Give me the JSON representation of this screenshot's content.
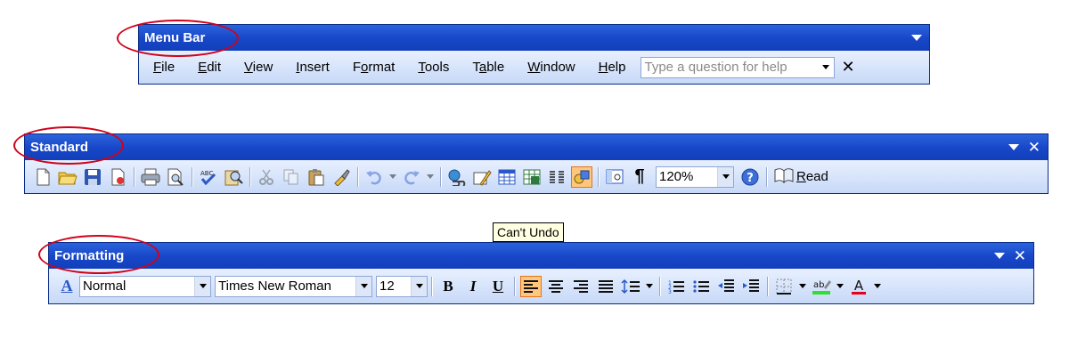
{
  "menubar": {
    "title": "Menu Bar",
    "items": [
      {
        "label": "File",
        "key": "F",
        "rest": "ile"
      },
      {
        "label": "Edit",
        "key": "E",
        "rest": "dit"
      },
      {
        "label": "View",
        "key": "V",
        "rest": "iew"
      },
      {
        "label": "Insert",
        "key": "I",
        "rest": "nsert"
      },
      {
        "label": "Format",
        "pre": "F",
        "key": "o",
        "rest": "rmat"
      },
      {
        "label": "Tools",
        "key": "T",
        "rest": "ools"
      },
      {
        "label": "Table",
        "pre": "T",
        "key": "a",
        "rest": "ble"
      },
      {
        "label": "Window",
        "key": "W",
        "rest": "indow"
      },
      {
        "label": "Help",
        "key": "H",
        "rest": "elp"
      }
    ],
    "ask_placeholder": "Type a question for help",
    "close_glyph": "✕"
  },
  "standard": {
    "title": "Standard",
    "zoom": "120%",
    "read_label": "Read",
    "read_key": "R",
    "read_rest": "ead",
    "pilcrow": "¶"
  },
  "formatting": {
    "title": "Formatting",
    "style": "Normal",
    "font": "Times New Roman",
    "size": "12",
    "bold": "B",
    "italic": "I",
    "underline": "U",
    "style_icon_text": "A"
  },
  "tooltip": {
    "text": "Can't Undo"
  },
  "colors": {
    "titlebar": "#1746c8",
    "annotation": "#d0021b",
    "highlight": "#ffc77d"
  }
}
